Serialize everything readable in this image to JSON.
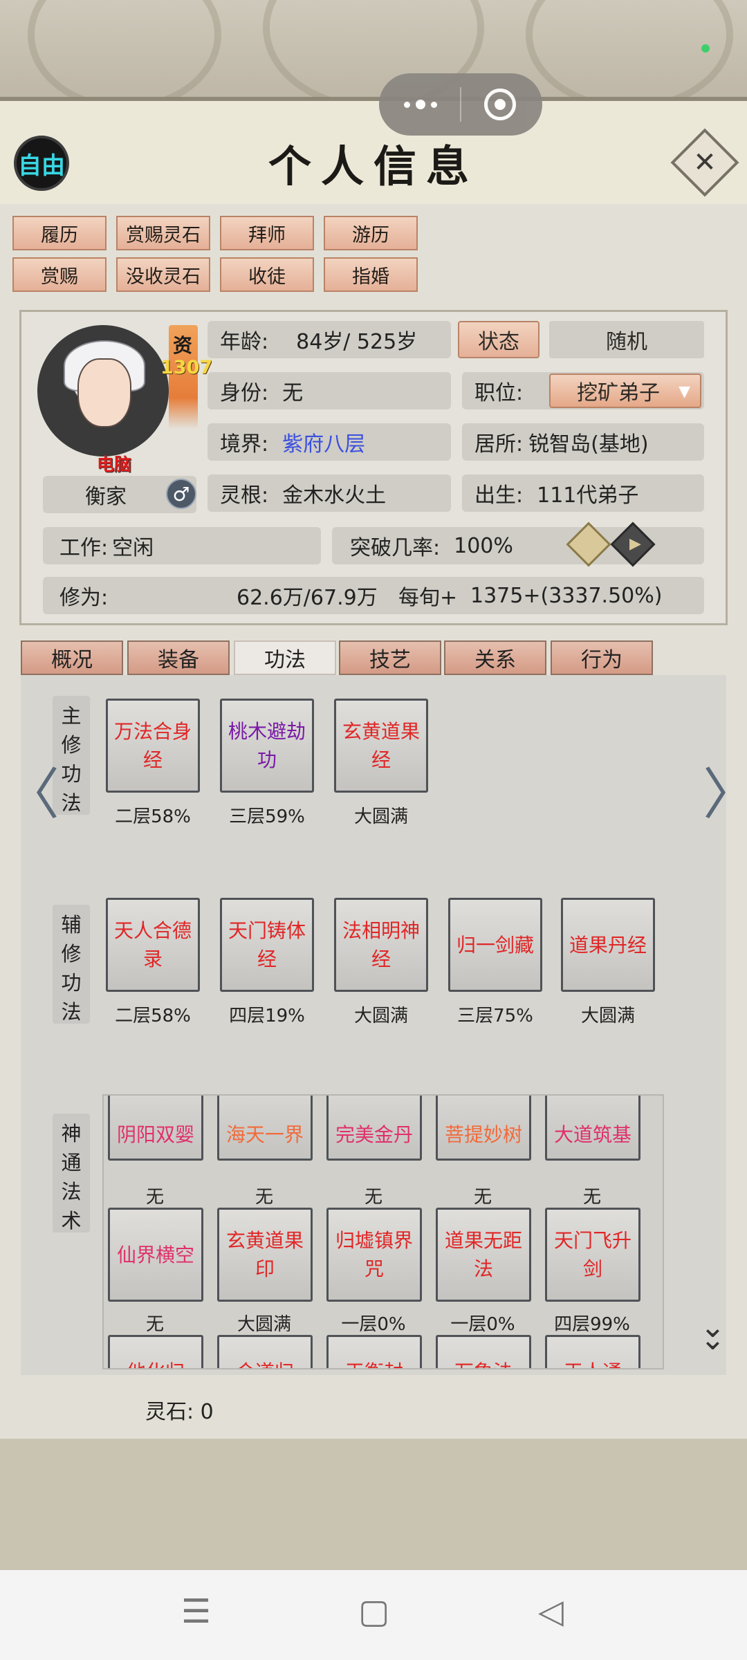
{
  "header": {
    "free_badge": "自由",
    "title": "个人信息",
    "close_icon": "close-icon"
  },
  "actions": [
    "履历",
    "赏赐灵石",
    "拜师",
    "游历",
    "赏赐",
    "没收灵石",
    "收徒",
    "指婚"
  ],
  "profile": {
    "aptitude_label": "资",
    "aptitude_value": "1307",
    "computer_tag": "电脑",
    "family": "衡家",
    "gender_icon": "♂",
    "age_label": "年龄:",
    "age_value": "84岁/ 525岁",
    "status_btn": "状态",
    "random_btn": "随机",
    "identity_label": "身份:",
    "identity_value": "无",
    "position_label": "职位:",
    "position_value": "挖矿弟子",
    "realm_label": "境界:",
    "realm_value": "紫府八层",
    "residence_label": "居所:",
    "residence_value": "锐智岛(基地)",
    "root_label": "灵根:",
    "root_value": "金木水火土",
    "birth_label": "出生:",
    "birth_value": "111代弟子",
    "work_label": "工作:",
    "work_value": "空闲",
    "breakthrough_label": "突破几率:",
    "breakthrough_value": "100%",
    "cultivation_label": "修为:",
    "cultivation_value": "62.6万/67.9万",
    "per_turn_label": "每旬+",
    "per_turn_value": "1375+(3337.50%)",
    "colors": {
      "realm": "#3b4fe0",
      "accent": "#e5b097"
    }
  },
  "tabs": [
    "概况",
    "装备",
    "功法",
    "技艺",
    "关系",
    "行为"
  ],
  "active_tab": "功法",
  "main_techniques": {
    "label": [
      "主",
      "修",
      "功",
      "法"
    ],
    "items": [
      {
        "name": "万法合身经",
        "level": "二层58%"
      },
      {
        "name": "桃木避劫功",
        "level": "三层59%"
      },
      {
        "name": "玄黄道果经",
        "level": "大圆满"
      }
    ]
  },
  "aux_techniques": {
    "label": [
      "辅",
      "修",
      "功",
      "法"
    ],
    "items": [
      {
        "name": "天人合德录",
        "level": "二层58%"
      },
      {
        "name": "天门铸体经",
        "level": "四层19%"
      },
      {
        "name": "法相明神经",
        "level": "大圆满"
      },
      {
        "name": "归一剑藏",
        "level": "三层75%"
      },
      {
        "name": "道果丹经",
        "level": "大圆满"
      }
    ]
  },
  "magic": {
    "label": [
      "神",
      "通",
      "法",
      "术"
    ],
    "row1": [
      {
        "name": "阴阳双婴",
        "level": "无"
      },
      {
        "name": "海天一界",
        "level": "无"
      },
      {
        "name": "完美金丹",
        "level": "无"
      },
      {
        "name": "菩提妙树",
        "level": "无"
      },
      {
        "name": "大道筑基",
        "level": "无"
      }
    ],
    "row2": [
      {
        "name": "仙界横空",
        "level": "无"
      },
      {
        "name": "玄黄道果印",
        "level": "大圆满"
      },
      {
        "name": "归墟镇界咒",
        "level": "一层0%"
      },
      {
        "name": "道果无距法",
        "level": "一层0%"
      },
      {
        "name": "天门飞升剑",
        "level": "四层99%"
      }
    ],
    "row3": [
      "他化归",
      "合道归",
      "天衡封",
      "万象法",
      "天人通"
    ]
  },
  "footer": {
    "spirit_stones": "灵石: 0"
  },
  "nav": {
    "menu": "☰",
    "home": "▢",
    "back": "◁"
  }
}
